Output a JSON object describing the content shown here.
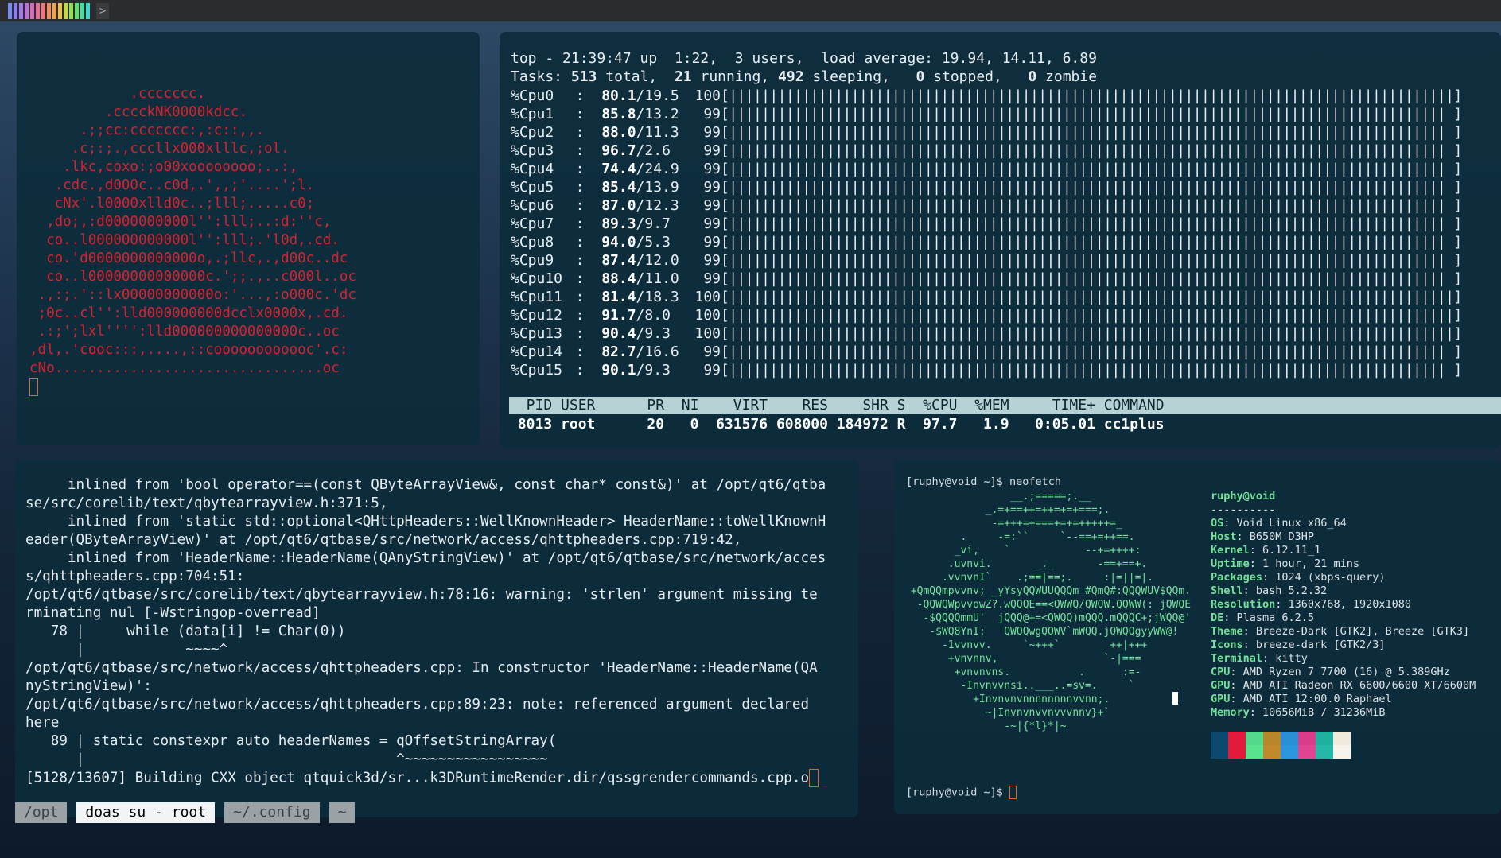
{
  "workspaces": {
    "colors": [
      "#7b8cf0",
      "#8d7df0",
      "#a07ae8",
      "#c070d8",
      "#d86ac0",
      "#e8709a",
      "#f0787a",
      "#f28a60",
      "#f0a050",
      "#e8c048",
      "#c0d848",
      "#90e050",
      "#60e070",
      "#40e0a0",
      "#40d8d0"
    ]
  },
  "topbar": {
    "icon": "terminal-icon",
    "icon_glyph": ">"
  },
  "ascii_logo": {
    "lines": [
      "            .ccccccc.",
      "         .cccckNK0000kdcc.",
      "      .;;cc:ccccccc:,:c::,,.",
      "     .c;:;.,cccllx000xlllc,;ol.",
      "    .lkc,coxo:;o00xoooooooo;..:,",
      "   .cdc.,d000c..c0d,.',,;'....';l.",
      "   cNx'.l0000xlld0c..;lll;.....c0;",
      "  ,do;,:d0000000000l'':lll;..:d:''c,",
      "  co..l000000000000l'':lll;.'l0d,.cd.",
      "  co.'d0000000000000o,.;llc,.,d00c..dc",
      "  co..l00000000000000c.';;.,..c000l..oc",
      " .,:;.'::lx00000000000o:'...,:o000c.'dc",
      " ;0c..cl'':lld000000000dcclx0000x,.cd.",
      " .:;';lxl'''':lld000000000000000c..oc",
      ",dl,.'cooc:::,....,::coooooooooooc'.c:",
      "cNo................................oc"
    ]
  },
  "top": {
    "header_line1": "top - 21:39:47 up  1:22,  3 users,  load average: 19.94, 14.11, 6.89",
    "tasks_label": "Tasks:",
    "tasks_total": "513",
    "tasks_total_label": "total,",
    "tasks_running": "21",
    "tasks_running_label": "running,",
    "tasks_sleeping": "492",
    "tasks_sleeping_label": "sleeping,",
    "tasks_stopped": "0",
    "tasks_stopped_label": "stopped,",
    "tasks_zombie": "0",
    "tasks_zombie_label": "zombie",
    "cpus": [
      {
        "name": "%Cpu0",
        "user": "80.1",
        "sys": "19.5",
        "max": "100"
      },
      {
        "name": "%Cpu1",
        "user": "85.8",
        "sys": "13.2",
        "max": "99"
      },
      {
        "name": "%Cpu2",
        "user": "88.0",
        "sys": "11.3",
        "max": "99"
      },
      {
        "name": "%Cpu3",
        "user": "96.7",
        "sys": "2.6",
        "max": "99"
      },
      {
        "name": "%Cpu4",
        "user": "74.4",
        "sys": "24.9",
        "max": "99"
      },
      {
        "name": "%Cpu5",
        "user": "85.4",
        "sys": "13.9",
        "max": "99"
      },
      {
        "name": "%Cpu6",
        "user": "87.0",
        "sys": "12.3",
        "max": "99"
      },
      {
        "name": "%Cpu7",
        "user": "89.3",
        "sys": "9.7",
        "max": "99"
      },
      {
        "name": "%Cpu8",
        "user": "94.0",
        "sys": "5.3",
        "max": "99"
      },
      {
        "name": "%Cpu9",
        "user": "87.4",
        "sys": "12.0",
        "max": "99"
      },
      {
        "name": "%Cpu10",
        "user": "88.4",
        "sys": "11.0",
        "max": "99"
      },
      {
        "name": "%Cpu11",
        "user": "81.4",
        "sys": "18.3",
        "max": "100"
      },
      {
        "name": "%Cpu12",
        "user": "91.7",
        "sys": "8.0",
        "max": "100"
      },
      {
        "name": "%Cpu13",
        "user": "90.4",
        "sys": "9.3",
        "max": "100"
      },
      {
        "name": "%Cpu14",
        "user": "82.7",
        "sys": "16.6",
        "max": "99"
      },
      {
        "name": "%Cpu15",
        "user": "90.1",
        "sys": "9.3",
        "max": "99"
      }
    ],
    "proc_header": "  PID USER      PR  NI    VIRT    RES    SHR S  %CPU  %MEM     TIME+ COMMAND",
    "proc_row": " 8013 root      20   0  631576 608000 184972 R  97.7   1.9   0:05.01 cc1plus"
  },
  "build": {
    "lines": [
      "     inlined from 'bool operator==(const QByteArrayView&, const char* const&)' at /opt/qt6/qtba",
      "se/src/corelib/text/qbytearrayview.h:371:5,",
      "     inlined from 'static std::optional<QHttpHeaders::WellKnownHeader> HeaderName::toWellKnownH",
      "eader(QByteArrayView)' at /opt/qt6/qtbase/src/network/access/qhttpheaders.cpp:719:42,",
      "     inlined from 'HeaderName::HeaderName(QAnyStringView)' at /opt/qt6/qtbase/src/network/acces",
      "s/qhttpheaders.cpp:704:51:",
      "/opt/qt6/qtbase/src/corelib/text/qbytearrayview.h:78:16: warning: 'strlen' argument missing te",
      "rminating nul [-Wstringop-overread]",
      "   78 |     while (data[i] != Char(0))",
      "      |            ~~~~^",
      "/opt/qt6/qtbase/src/network/access/qhttpheaders.cpp: In constructor 'HeaderName::HeaderName(QA",
      "nyStringView)':",
      "/opt/qt6/qtbase/src/network/access/qhttpheaders.cpp:89:23: note: referenced argument declared",
      "here",
      "   89 | static constexpr auto headerNames = qOffsetStringArray(",
      "      |                                     ^~~~~~~~~~~~~~~~~~",
      "[5128/13607] Building CXX object qtquick3d/sr...k3DRuntimeRender.dir/qssgrendercommands.cpp.o"
    ]
  },
  "tabs": [
    {
      "label": "/opt",
      "active": false
    },
    {
      "label": "doas su - root",
      "active": true
    },
    {
      "label": "~/.config",
      "active": false
    },
    {
      "label": "~",
      "active": false
    }
  ],
  "neofetch": {
    "prompt_cmd": "[ruphy@void ~]$ neofetch",
    "prompt_end": "[ruphy@void ~]$ ",
    "user_host": "ruphy@void",
    "separator": "----------",
    "info": [
      {
        "key": "OS",
        "value": "Void Linux x86_64"
      },
      {
        "key": "Host",
        "value": "B650M D3HP"
      },
      {
        "key": "Kernel",
        "value": "6.12.11_1"
      },
      {
        "key": "Uptime",
        "value": "1 hour, 21 mins"
      },
      {
        "key": "Packages",
        "value": "1024 (xbps-query)"
      },
      {
        "key": "Shell",
        "value": "bash 5.2.32"
      },
      {
        "key": "Resolution",
        "value": "1360x768, 1920x1080"
      },
      {
        "key": "DE",
        "value": "Plasma 6.2.5"
      },
      {
        "key": "Theme",
        "value": "Breeze-Dark [GTK2], Breeze [GTK3]"
      },
      {
        "key": "Icons",
        "value": "breeze-dark [GTK2/3]"
      },
      {
        "key": "Terminal",
        "value": "kitty"
      },
      {
        "key": "CPU",
        "value": "AMD Ryzen 7 7700 (16) @ 5.389GHz"
      },
      {
        "key": "GPU",
        "value": "AMD ATI Radeon RX 6600/6600 XT/6600M"
      },
      {
        "key": "GPU",
        "value": "AMD ATI 12:00.0 Raphael"
      },
      {
        "key": "Memory",
        "value": "10656MiB / 31236MiB"
      }
    ],
    "art_lines": [
      "                 __.;=====;.__",
      "             _.=+==++=++=+=+===;.",
      "              -=+++=+===+=+=+++++=_",
      "         .     -=:``     `--==+=++==.",
      "        _vi,    `            --+=++++:",
      "       .uvnvi.       _._       -==+==+.",
      "      .vvnvnI`    .;==|==;.     :|=||=|.",
      " +QmQQmpvvnv; _yYsyQQWUUQQQm #QmQ#:QQQWUV$QQm.",
      "  -QQWQWpvvowZ?.wQQQE==<QWWQ/QWQW.QQWW(: jQWQE",
      "   -$QQQQmmU'  jQQQ@+=<QWQQ)mQQQ.mQQQC+;jWQQ@'",
      "    -$WQ8YnI:   QWQQwgQQWV`mWQQ.jQWQQgyyWW@!",
      "      -1vvnvv.     `~+++`        ++|+++",
      "       +vnvnnv,                 `-|===",
      "        +vnvnvns.           .      :=-",
      "         -Invnvvnsi..___..=sv=.     `",
      "           +Invnvnvnnnnnnnnvvnn;.",
      "             ~|Invnvnvvnvvvnnv}+`",
      "                -~|{*l}*|~"
    ],
    "palette": [
      "#0b4a6e",
      "#e21b3c",
      "#52d98a",
      "#b8862b",
      "#2b8fd6",
      "#d83d8a",
      "#20b0a0",
      "#f0eadc"
    ],
    "palette_bottom": [
      "#0b4a6e",
      "#e21b3c",
      "#5ae38e",
      "#c08a2a",
      "#2b95de",
      "#e04592",
      "#25b8a6",
      "#f7f3ea"
    ]
  }
}
